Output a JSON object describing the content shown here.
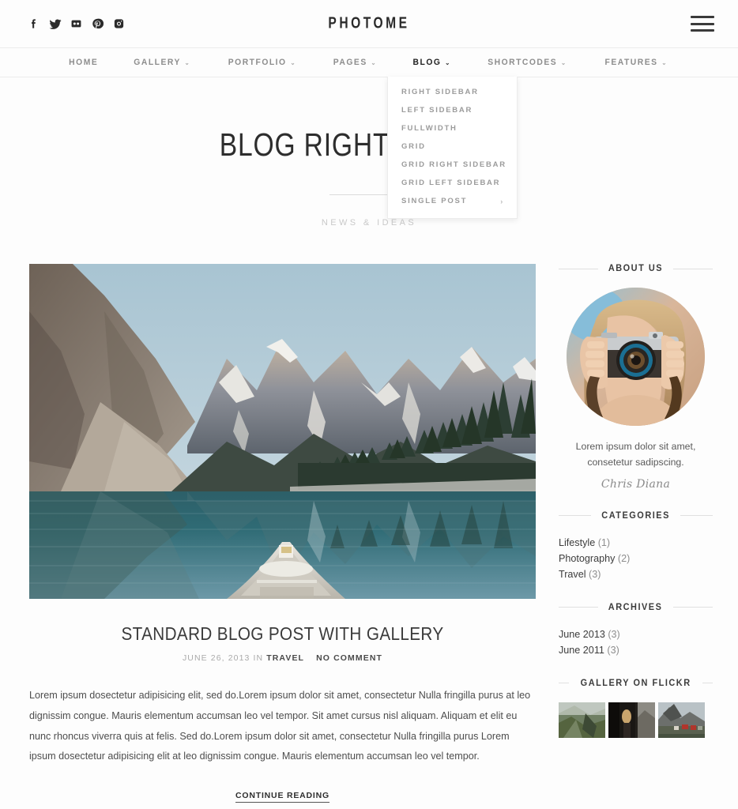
{
  "topbar": {
    "brand": "PHOTOME",
    "social": [
      {
        "name": "facebook-icon",
        "label": "Facebook"
      },
      {
        "name": "twitter-icon",
        "label": "Twitter"
      },
      {
        "name": "flickr-icon",
        "label": "Flickr"
      },
      {
        "name": "pinterest-icon",
        "label": "Pinterest"
      },
      {
        "name": "instagram-icon",
        "label": "Instagram"
      }
    ],
    "menu_toggle": "menu-icon"
  },
  "nav": {
    "items": [
      {
        "label": "HOME",
        "has_caret": false,
        "active": false
      },
      {
        "label": "GALLERY",
        "has_caret": true,
        "active": false
      },
      {
        "label": "PORTFOLIO",
        "has_caret": true,
        "active": false
      },
      {
        "label": "PAGES",
        "has_caret": true,
        "active": false
      },
      {
        "label": "BLOG",
        "has_caret": true,
        "active": true
      },
      {
        "label": "SHORTCODES",
        "has_caret": true,
        "active": false
      },
      {
        "label": "FEATURES",
        "has_caret": true,
        "active": false
      }
    ],
    "caret_glyph": "⌄"
  },
  "dropdown": {
    "open_for": "BLOG",
    "items": [
      {
        "label": "RIGHT SIDEBAR",
        "submenu": false
      },
      {
        "label": "LEFT SIDEBAR",
        "submenu": false
      },
      {
        "label": "FULLWIDTH",
        "submenu": false
      },
      {
        "label": "GRID",
        "submenu": false
      },
      {
        "label": "GRID RIGHT SIDEBAR",
        "submenu": false
      },
      {
        "label": "GRID LEFT SIDEBAR",
        "submenu": false
      },
      {
        "label": "SINGLE POST",
        "submenu": true
      }
    ],
    "submenu_glyph": "›"
  },
  "page": {
    "title": "BLOG RIGHT SIDEBAR",
    "subtitle": "NEWS & IDEAS"
  },
  "post": {
    "image_alt": "Canoe on turquoise mountain lake with snow-capped peaks and pine forest",
    "title": "STANDARD BLOG POST WITH GALLERY",
    "date": "JUNE 26, 2013",
    "in_label": "IN",
    "category": "TRAVEL",
    "comments": "NO COMMENT",
    "body": "Lorem ipsum dosectetur adipisicing elit, sed do.Lorem ipsum dolor sit amet, consectetur Nulla fringilla purus at leo dignissim congue. Mauris elementum accumsan leo vel tempor. Sit amet cursus nisl aliquam. Aliquam et elit eu nunc rhoncus viverra quis at felis. Sed do.Lorem ipsum dolor sit amet, consectetur Nulla fringilla purus Lorem ipsum dosectetur adipisicing elit at leo dignissim congue. Mauris elementum accumsan leo vel tempor.",
    "continue_label": "CONTINUE READING"
  },
  "sidebar": {
    "about": {
      "title": "ABOUT US",
      "avatar_alt": "Woman holding a vintage film camera to her face",
      "text_line1": "Lorem ipsum dolor sit amet,",
      "text_line2": "consetetur sadipscing.",
      "signature": "Chris Diana"
    },
    "categories": {
      "title": "CATEGORIES",
      "items": [
        {
          "name": "Lifestyle",
          "count": "(1)"
        },
        {
          "name": "Photography",
          "count": "(2)"
        },
        {
          "name": "Travel",
          "count": "(3)"
        }
      ]
    },
    "archives": {
      "title": "ARCHIVES",
      "items": [
        {
          "name": "June 2013",
          "count": "(3)"
        },
        {
          "name": "June 2011",
          "count": "(3)"
        }
      ]
    },
    "flickr": {
      "title": "GALLERY ON FLICKR",
      "thumbs": [
        {
          "alt": "Misty green hillside with rocky path"
        },
        {
          "alt": "Dark doorway with person silhouette"
        },
        {
          "alt": "Red fishing village beneath rocky mountain"
        }
      ]
    }
  },
  "colors": {
    "background": "#fdfdfd",
    "text": "#333333",
    "muted": "#8d8d8d",
    "rule": "#ececec",
    "accent_dark": "#1f1f1f"
  }
}
